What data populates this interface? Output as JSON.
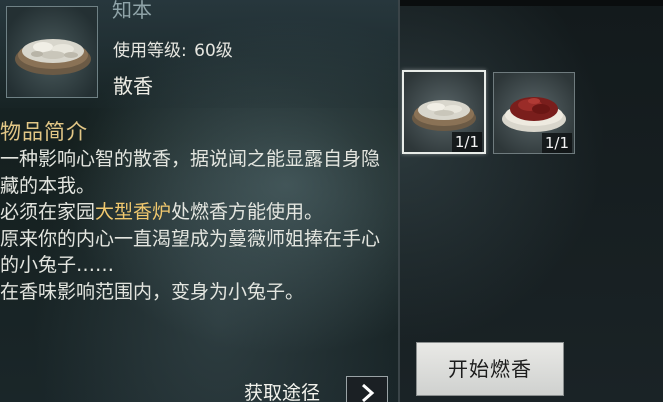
{
  "item": {
    "name": "知本",
    "level_label": "使用等级:",
    "level_value": "60级",
    "type": "散香"
  },
  "description": {
    "title": "物品简介",
    "line1": "一种影响心智的散香，据说闻之能显露自身隐藏的本我。",
    "line2_pre": "必须在家园",
    "line2_highlight": "大型香炉",
    "line2_post": "处燃香方能使用。",
    "line3": "原来你的内心一直渴望成为蔓薇师姐捧在手心的小兔子……",
    "line4": "在香味影响范围内，变身为小兔子。"
  },
  "source": {
    "label": "获取途径"
  },
  "slots": [
    {
      "quantity": "1/1",
      "icon": "rice-bowl-icon",
      "selected": true
    },
    {
      "quantity": "1/1",
      "icon": "red-incense-bowl-icon",
      "selected": false
    }
  ],
  "actions": {
    "start_label": "开始燃香"
  },
  "colors": {
    "highlight": "#f0c86e",
    "title": "#e2c786"
  }
}
